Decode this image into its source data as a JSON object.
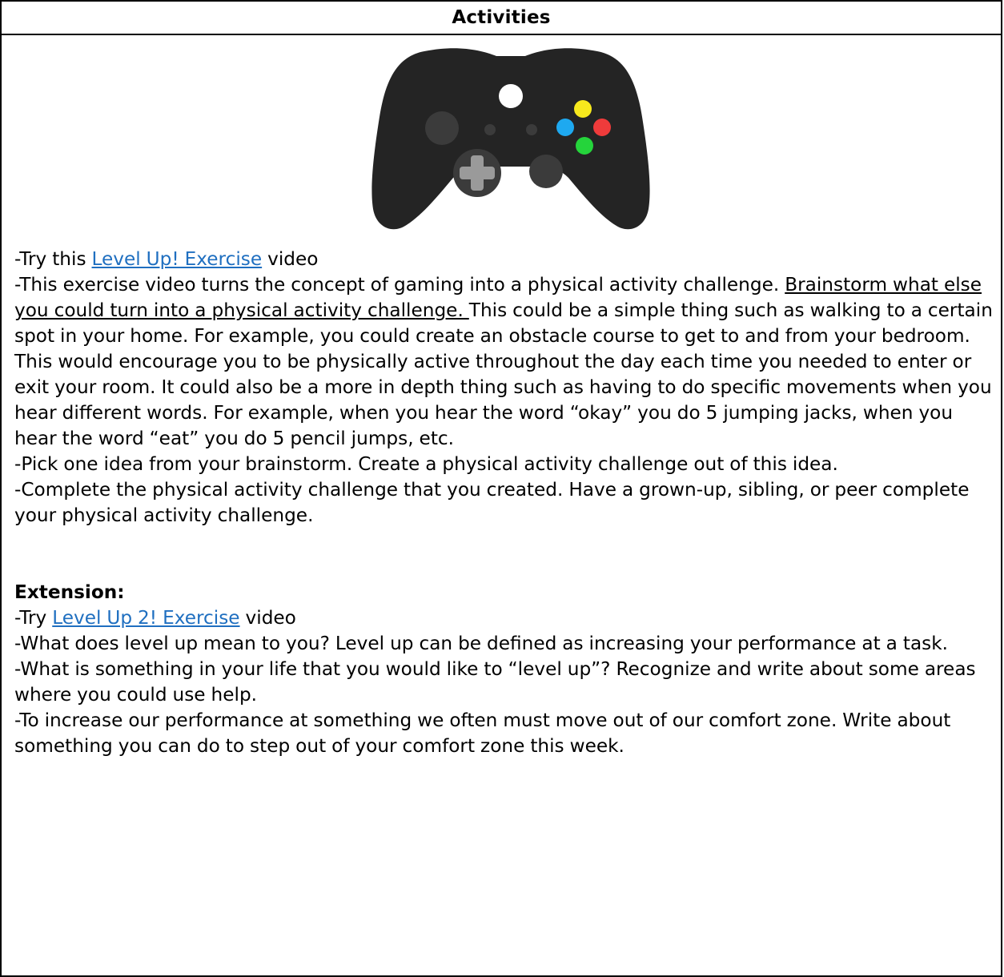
{
  "header": {
    "title": "Activities"
  },
  "image": {
    "icon": "game-controller-icon",
    "colors": {
      "body": "#242424",
      "button_dark": "#3b3b3b",
      "button_white": "#ffffff",
      "button_yellow": "#f7e91d",
      "button_blue": "#1ea9f0",
      "button_red": "#ef3b3b",
      "button_green": "#25d43b",
      "dpad": "#9a9a9a"
    }
  },
  "activities": {
    "p1": {
      "prefix": "-Try this ",
      "link": "Level Up! Exercise",
      "suffix": " video"
    },
    "p2": {
      "intro": "-This exercise video turns the concept of gaming into a physical activity challenge. ",
      "underlined": "Brainstorm what else you could turn into a physical activity challenge. ",
      "rest": "This could be a simple thing such as walking to a certain spot in your home. For example, you could create an obstacle course to get to and from your bedroom. This would encourage you to be physically active throughout the day each time you needed to enter or exit your room. It could also be a more in depth thing such as having to do specific movements when you hear different words. For example, when you hear the word “okay” you do 5 jumping jacks, when you hear the word “eat” you do 5 pencil jumps, etc."
    },
    "p3": "-Pick one idea from your brainstorm. Create a physical activity challenge out of this idea.",
    "p4": "-Complete the physical activity challenge that you created. Have a grown-up, sibling, or peer complete your physical activity challenge."
  },
  "extension": {
    "heading": "Extension:",
    "p1": {
      "prefix": "-Try ",
      "link": "Level Up 2! Exercise",
      "suffix": " video"
    },
    "p2": "-What does level up mean to you? Level up can be defined as increasing your performance at a task.",
    "p3": "-What is something in your life that you would like to “level up”? Recognize and write about some areas where you could use help.",
    "p4": "-To increase our performance at something we often must move out of our comfort zone. Write about something you can do to step out of your comfort zone this week."
  }
}
